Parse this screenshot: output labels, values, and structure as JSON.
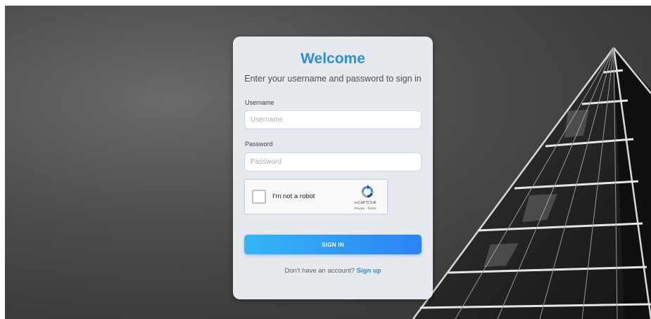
{
  "login": {
    "title": "Welcome",
    "subtitle": "Enter your username and password to sign in",
    "username_label": "Username",
    "username_placeholder": "Username",
    "username_value": "",
    "password_label": "Password",
    "password_placeholder": "Password",
    "password_value": "",
    "signin_label": "SIGN IN",
    "footer_prompt": "Don't have an account?",
    "signup_link": "Sign up"
  },
  "captcha": {
    "label": "I'm not a robot",
    "brand": "reCAPTCHA",
    "links": "Privacy - Terms",
    "checked": false
  },
  "colors": {
    "accent": "#2d8fd9",
    "button_start": "#34b6f5",
    "button_end": "#2d83f4",
    "card_background": "#e6eaee"
  },
  "icons": {
    "captcha_logo": "recaptcha-icon",
    "background": "glass-building-image"
  }
}
